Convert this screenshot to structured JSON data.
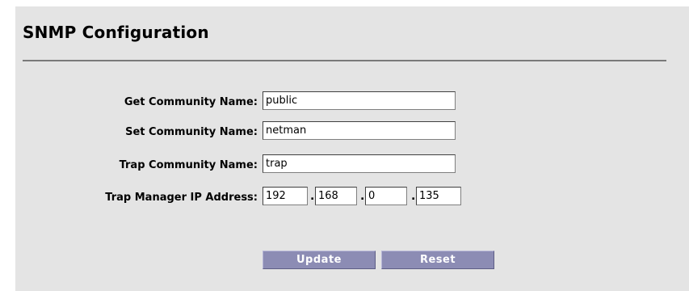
{
  "page": {
    "title": "SNMP Configuration"
  },
  "form": {
    "get_community": {
      "label": "Get Community Name:",
      "value": "public"
    },
    "set_community": {
      "label": "Set Community Name:",
      "value": "netman"
    },
    "trap_community": {
      "label": "Trap Community Name:",
      "value": "trap"
    },
    "trap_manager_ip": {
      "label": "Trap Manager IP Address:",
      "octets": [
        "192",
        "168",
        "0",
        "135"
      ],
      "separator": "."
    }
  },
  "buttons": {
    "update": "Update",
    "reset": "Reset"
  },
  "colors": {
    "panel_bg": "#e4e4e4",
    "button_bg": "#8c8cb4",
    "rule": "#7a7a7a"
  }
}
